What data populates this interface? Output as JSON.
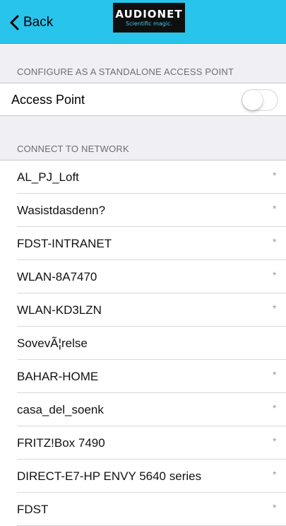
{
  "nav": {
    "back_label": "Back",
    "logo_text": "AUDIONET",
    "logo_tagline": "Scientific magic."
  },
  "access_point_section": {
    "header": "CONFIGURE AS A STANDALONE ACCESS POINT",
    "label": "Access Point",
    "toggle_on": false
  },
  "network_section": {
    "header": "CONNECT TO NETWORK",
    "networks": [
      {
        "name": "AL_PJ_Loft",
        "secured_marker": "*"
      },
      {
        "name": "Wasistdasdenn?",
        "secured_marker": "*"
      },
      {
        "name": "FDST-INTRANET",
        "secured_marker": "*"
      },
      {
        "name": "WLAN-8A7470",
        "secured_marker": "*"
      },
      {
        "name": "WLAN-KD3LZN",
        "secured_marker": "*"
      },
      {
        "name": "SovevÃ¦relse",
        "secured_marker": ""
      },
      {
        "name": "BAHAR-HOME",
        "secured_marker": "*"
      },
      {
        "name": "casa_del_soenk",
        "secured_marker": "*"
      },
      {
        "name": "FRITZ!Box 7490",
        "secured_marker": "*"
      },
      {
        "name": "DIRECT-E7-HP ENVY 5640 series",
        "secured_marker": "*"
      },
      {
        "name": "FDST",
        "secured_marker": "*"
      }
    ]
  },
  "colors": {
    "nav_background": "#29c4ec",
    "page_background": "#efeff4",
    "logo_background": "#0f0f0f"
  }
}
